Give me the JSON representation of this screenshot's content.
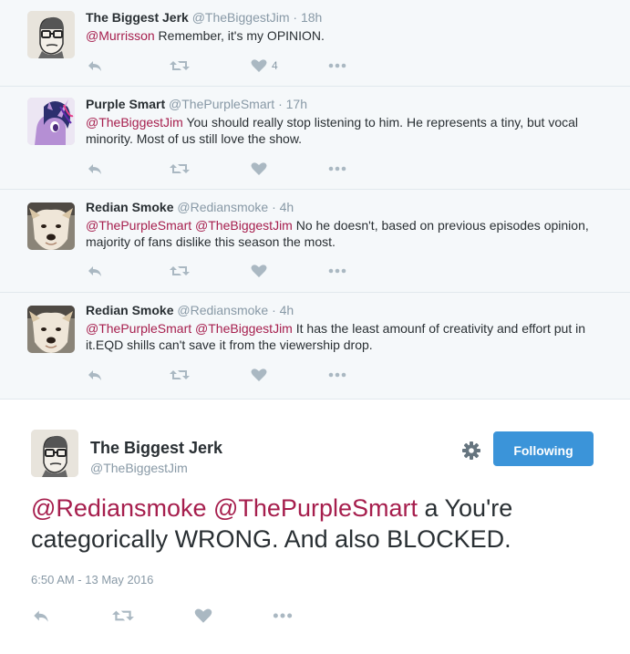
{
  "replies": [
    {
      "name": "The Biggest Jerk",
      "handle": "@TheBiggestJim",
      "dot": "·",
      "time": "18h",
      "mentions": "@Murrisson",
      "text": " Remember, it's my OPINION.",
      "like_count": "4",
      "avatar": "sketch-face"
    },
    {
      "name": "Purple Smart",
      "handle": "@ThePurpleSmart",
      "dot": "·",
      "time": "17h",
      "mentions": "@TheBiggestJim",
      "text": " You should really stop listening to him. He represents a tiny, but vocal minority. Most of us still love the show.",
      "like_count": "",
      "avatar": "purple-pony"
    },
    {
      "name": "Redian Smoke",
      "handle": "@Rediansmoke",
      "dot": "·",
      "time": "4h",
      "mentions": "@ThePurpleSmart @TheBiggestJim",
      "text": " No he doesn't, based on previous episodes opinion, majority of fans dislike this season the most.",
      "like_count": "",
      "avatar": "dog"
    },
    {
      "name": "Redian Smoke",
      "handle": "@Rediansmoke",
      "dot": "·",
      "time": "4h",
      "mentions": "@ThePurpleSmart @TheBiggestJim",
      "text": " It has the least amounf of creativity and effort put in it.EQD shills can't save it from the viewership drop.",
      "like_count": "",
      "avatar": "dog"
    }
  ],
  "main": {
    "name": "The Biggest Jerk",
    "handle": "@TheBiggestJim",
    "follow_label": "Following",
    "mentions": "@Rediansmoke @ThePurpleSmart",
    "text": " a You're categorically WRONG. And also BLOCKED.",
    "timestamp": "6:50 AM - 13 May 2016"
  },
  "colors": {
    "mention": "#a61e4d",
    "follow_button": "#3b94d9",
    "icon": "#aab8c2",
    "thread_bg": "#f5f8fa"
  },
  "icons": [
    "reply-icon",
    "retweet-icon",
    "like-icon",
    "more-icon",
    "gear-icon"
  ]
}
